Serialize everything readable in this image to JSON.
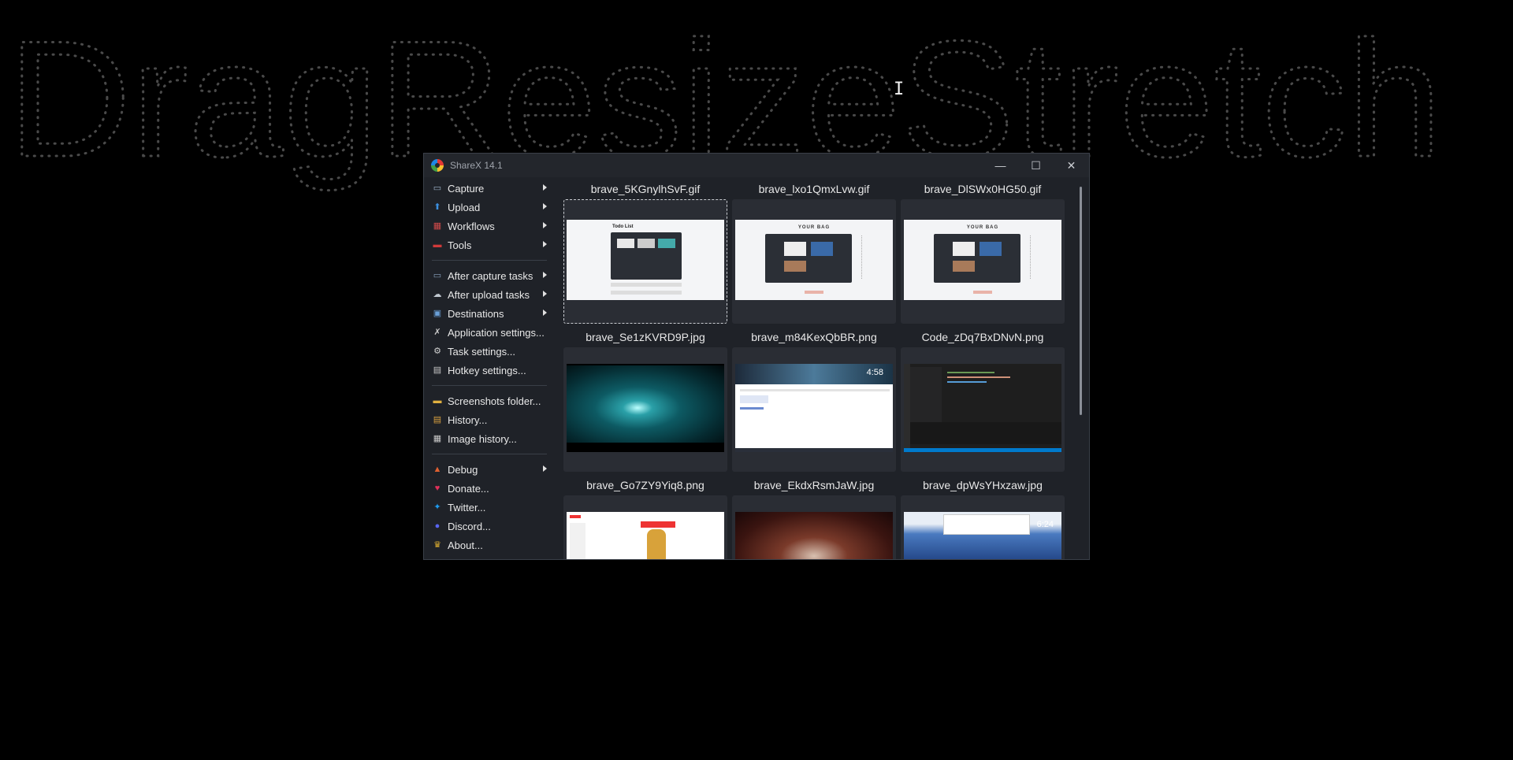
{
  "background": {
    "wallpaper_text": "DragResizeStretch"
  },
  "window": {
    "title": "ShareX 14.1",
    "controls": {
      "minimize": "—",
      "maximize": "☐",
      "close": "✕"
    }
  },
  "menu": {
    "items": [
      {
        "label": "Capture",
        "icon": "camera-icon",
        "submenu": true
      },
      {
        "label": "Upload",
        "icon": "upload-arrow-icon",
        "submenu": true
      },
      {
        "label": "Workflows",
        "icon": "workflows-grid-icon",
        "submenu": true
      },
      {
        "label": "Tools",
        "icon": "toolbox-icon",
        "submenu": true
      },
      {
        "separator": true
      },
      {
        "label": "After capture tasks",
        "icon": "after-capture-icon",
        "submenu": true
      },
      {
        "label": "After upload tasks",
        "icon": "cloud-upload-icon",
        "submenu": true
      },
      {
        "label": "Destinations",
        "icon": "destinations-icon",
        "submenu": true
      },
      {
        "label": "Application settings...",
        "icon": "wrench-icon",
        "submenu": false
      },
      {
        "label": "Task settings...",
        "icon": "gear-icon",
        "submenu": false
      },
      {
        "label": "Hotkey settings...",
        "icon": "keyboard-icon",
        "submenu": false
      },
      {
        "separator": true
      },
      {
        "label": "Screenshots folder...",
        "icon": "folder-icon",
        "submenu": false
      },
      {
        "label": "History...",
        "icon": "history-icon",
        "submenu": false
      },
      {
        "label": "Image history...",
        "icon": "image-history-icon",
        "submenu": false
      },
      {
        "separator": true
      },
      {
        "label": "Debug",
        "icon": "debug-cone-icon",
        "submenu": true
      },
      {
        "label": "Donate...",
        "icon": "heart-icon",
        "submenu": false
      },
      {
        "label": "Twitter...",
        "icon": "twitter-icon",
        "submenu": false
      },
      {
        "label": "Discord...",
        "icon": "discord-icon",
        "submenu": false
      },
      {
        "label": "About...",
        "icon": "crown-icon",
        "submenu": false
      }
    ]
  },
  "gallery": {
    "files": [
      {
        "name": "brave_5KGnylhSvF.gif",
        "preview": "todo-list",
        "selected": true
      },
      {
        "name": "brave_lxo1QmxLvw.gif",
        "preview": "your-bag"
      },
      {
        "name": "brave_DlSWx0HG50.gif",
        "preview": "your-bag"
      },
      {
        "name": "brave_Se1zKVRD9P.jpg",
        "preview": "teal-dark"
      },
      {
        "name": "brave_m84KexQbBR.png",
        "preview": "browser-page",
        "overlay_text": "4:58"
      },
      {
        "name": "Code_zDq7BxDNvN.png",
        "preview": "code-editor"
      },
      {
        "name": "brave_Go7ZY9Yiq8.png",
        "preview": "youtube-page"
      },
      {
        "name": "brave_EkdxRsmJaW.jpg",
        "preview": "concert"
      },
      {
        "name": "brave_dpWsYHxzaw.jpg",
        "preview": "earth-page",
        "overlay_text": "6:24"
      }
    ],
    "preview_labels": {
      "todo_list": "Todo List",
      "your_bag": "YOUR BAG"
    }
  },
  "colors": {
    "window_bg": "#1f2228",
    "titlebar_bg": "#23262c",
    "thumb_bg": "#2a2d34",
    "text": "#e8e8e8"
  }
}
